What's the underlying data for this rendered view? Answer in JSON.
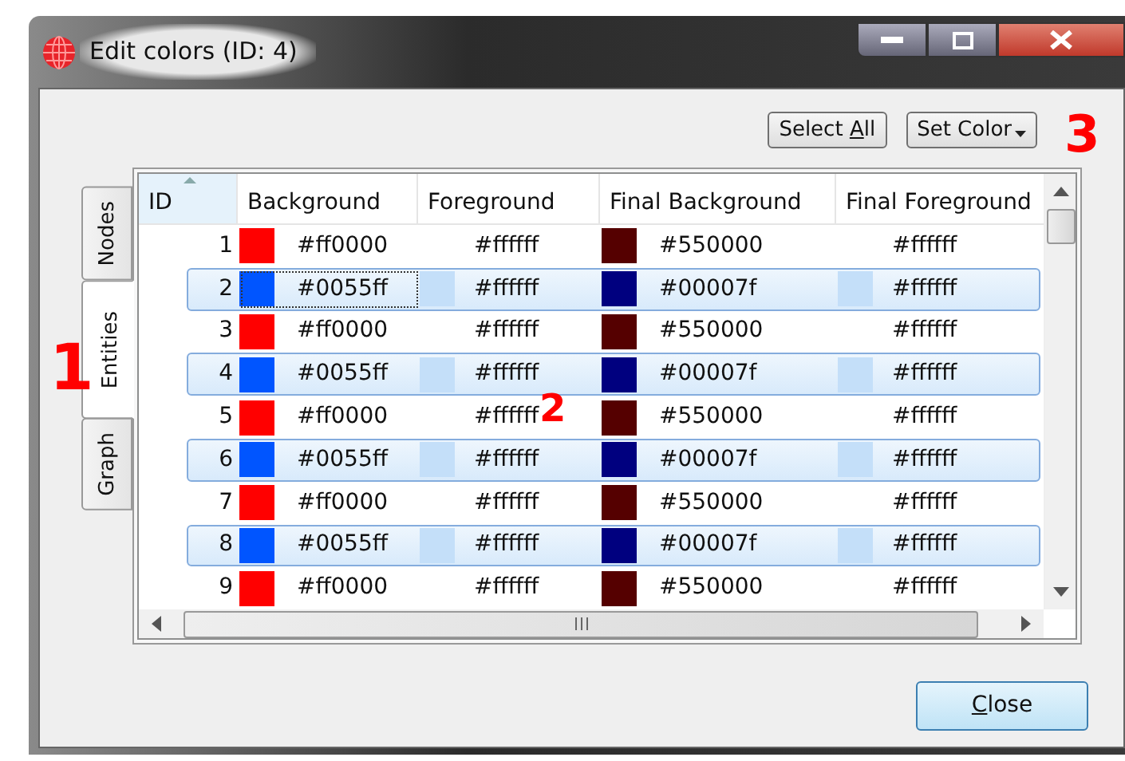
{
  "window": {
    "title": "Edit colors (ID: 4)"
  },
  "toolbar": {
    "buttons": [
      {
        "label": "Select ",
        "accel": "A",
        "rest": "ll",
        "dropdown": false
      },
      {
        "label": "Set Color",
        "dropdown": true
      }
    ]
  },
  "tabs": [
    {
      "label": "Nodes",
      "selected": false
    },
    {
      "label": "Entities",
      "selected": true
    },
    {
      "label": "Graph",
      "selected": false
    }
  ],
  "table": {
    "columns": [
      "ID",
      "Background",
      "Foreground",
      "Final Background",
      "Final Foreground"
    ],
    "rows": [
      {
        "selected": false,
        "cells": [
          {
            "text": "1"
          },
          {
            "text": "#ff0000",
            "color": "#ff0000",
            "focused": false
          },
          {
            "text": "#ffffff",
            "focused": false
          },
          {
            "text": "#550000",
            "color": "#550000",
            "focused": false
          },
          {
            "text": "#ffffff",
            "focused": false
          }
        ]
      },
      {
        "selected": true,
        "cells": [
          {
            "text": "2"
          },
          {
            "text": "#0055ff",
            "color": "#0055ff",
            "focused": true
          },
          {
            "text": "#ffffff",
            "color": "#c4dff9",
            "focused": false
          },
          {
            "text": "#00007f",
            "color": "#00007f",
            "focused": false
          },
          {
            "text": "#ffffff",
            "color": "#c4dff9",
            "focused": false
          }
        ]
      },
      {
        "selected": false,
        "cells": [
          {
            "text": "3"
          },
          {
            "text": "#ff0000",
            "color": "#ff0000",
            "focused": false
          },
          {
            "text": "#ffffff",
            "focused": false
          },
          {
            "text": "#550000",
            "color": "#550000",
            "focused": false
          },
          {
            "text": "#ffffff",
            "focused": false
          }
        ]
      },
      {
        "selected": true,
        "cells": [
          {
            "text": "4"
          },
          {
            "text": "#0055ff",
            "color": "#0055ff",
            "focused": false
          },
          {
            "text": "#ffffff",
            "color": "#c4dff9",
            "focused": false
          },
          {
            "text": "#00007f",
            "color": "#00007f",
            "focused": false
          },
          {
            "text": "#ffffff",
            "color": "#c4dff9",
            "focused": false
          }
        ]
      },
      {
        "selected": false,
        "cells": [
          {
            "text": "5"
          },
          {
            "text": "#ff0000",
            "color": "#ff0000",
            "focused": false
          },
          {
            "text": "#ffffff",
            "focused": false
          },
          {
            "text": "#550000",
            "color": "#550000",
            "focused": false
          },
          {
            "text": "#ffffff",
            "focused": false
          }
        ]
      },
      {
        "selected": true,
        "cells": [
          {
            "text": "6"
          },
          {
            "text": "#0055ff",
            "color": "#0055ff",
            "focused": false
          },
          {
            "text": "#ffffff",
            "color": "#c4dff9",
            "focused": false
          },
          {
            "text": "#00007f",
            "color": "#00007f",
            "focused": false
          },
          {
            "text": "#ffffff",
            "color": "#c4dff9",
            "focused": false
          }
        ]
      },
      {
        "selected": false,
        "cells": [
          {
            "text": "7"
          },
          {
            "text": "#ff0000",
            "color": "#ff0000",
            "focused": false
          },
          {
            "text": "#ffffff",
            "focused": false
          },
          {
            "text": "#550000",
            "color": "#550000",
            "focused": false
          },
          {
            "text": "#ffffff",
            "focused": false
          }
        ]
      },
      {
        "selected": true,
        "cells": [
          {
            "text": "8"
          },
          {
            "text": "#0055ff",
            "color": "#0055ff",
            "focused": false
          },
          {
            "text": "#ffffff",
            "color": "#c4dff9",
            "focused": false
          },
          {
            "text": "#00007f",
            "color": "#00007f",
            "focused": false
          },
          {
            "text": "#ffffff",
            "color": "#c4dff9",
            "focused": false
          }
        ]
      },
      {
        "selected": false,
        "cells": [
          {
            "text": "9"
          },
          {
            "text": "#ff0000",
            "color": "#ff0000",
            "focused": false
          },
          {
            "text": "#ffffff",
            "focused": false
          },
          {
            "text": "#550000",
            "color": "#550000",
            "focused": false
          },
          {
            "text": "#ffffff",
            "focused": false
          }
        ]
      }
    ]
  },
  "footer": {
    "close_button": {
      "accel": "C",
      "rest": "lose"
    }
  },
  "annotations": [
    "1",
    "2",
    "3"
  ]
}
